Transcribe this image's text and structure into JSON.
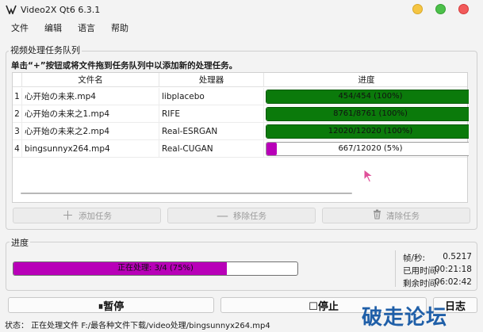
{
  "window": {
    "title": "Video2X Qt6 6.3.1"
  },
  "menu": [
    "文件",
    "编辑",
    "语言",
    "帮助"
  ],
  "queue": {
    "group_title": "视频处理任务队列",
    "hint": "单击“+”按钮或将文件拖到任务队列中以添加新的处理任务。",
    "columns": [
      "文件名",
      "处理器",
      "进度"
    ],
    "rows": [
      {
        "num": "1",
        "file": "心开始の未来.mp4",
        "processor": "libplacebo",
        "progress_text": "454/454 (100%)",
        "fraction": 1.0,
        "color": "#0b7a0b"
      },
      {
        "num": "2",
        "file": "心开始の未来之1.mp4",
        "processor": "RIFE",
        "progress_text": "8761/8761 (100%)",
        "fraction": 1.0,
        "color": "#0b7a0b"
      },
      {
        "num": "3",
        "file": "心开始の未来之2.mp4",
        "processor": "Real-ESRGAN",
        "progress_text": "12020/12020 (100%)",
        "fraction": 1.0,
        "color": "#0b7a0b"
      },
      {
        "num": "4",
        "file": "bingsunnyx264.mp4",
        "processor": "Real-CUGAN",
        "progress_text": "667/12020 (5%)",
        "fraction": 0.05,
        "color": "#b800b8"
      }
    ],
    "buttons": {
      "add": "添加任务",
      "remove": "移除任务",
      "clear": "清除任务"
    }
  },
  "progress": {
    "group_title": "进度",
    "overall_text": "正在处理: 3/4 (75%)",
    "overall_fraction": 0.75,
    "fill_color": "#b800b8",
    "stats": [
      {
        "label": "帧/秒:",
        "value": "0.5217"
      },
      {
        "label": "已用时间:",
        "value": "00:21:18"
      },
      {
        "label": "剩余时间:",
        "value": "06:02:42"
      }
    ]
  },
  "controls": {
    "pause": "⏸暂停",
    "stop": "☐停止",
    "log": "日志"
  },
  "status": {
    "text": "状态： 正在处理文件 F:/最各种文件下载/video处理/bingsunnyx264.mp4"
  },
  "watermark": "破走论坛"
}
